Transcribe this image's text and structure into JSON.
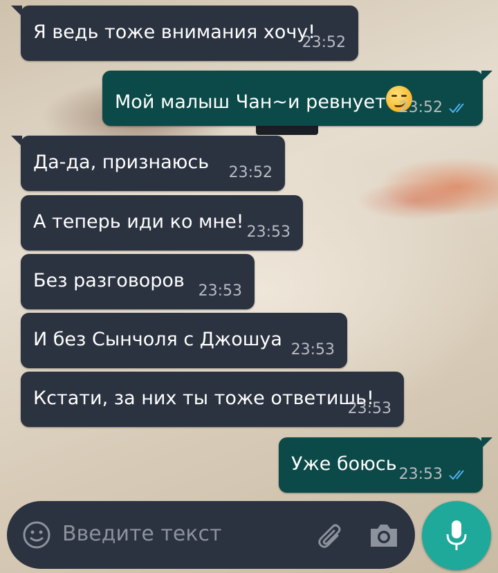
{
  "chat": {
    "messages": [
      {
        "direction": "incoming",
        "text": "Я ведь тоже внимания хочу!",
        "time": "23:52"
      },
      {
        "direction": "outgoing",
        "text": "Мой малыш Чан~и ревнует",
        "emoji": "smirking-face",
        "time": "23:52",
        "status": "read"
      },
      {
        "direction": "incoming",
        "text": "Да-да, признаюсь",
        "time": "23:52"
      },
      {
        "direction": "incoming",
        "text": "А теперь иди ко мне!",
        "time": "23:53"
      },
      {
        "direction": "incoming",
        "text": "Без разговоров",
        "time": "23:53"
      },
      {
        "direction": "incoming",
        "text": "И без Сынчоля с Джошуа",
        "time": "23:53"
      },
      {
        "direction": "incoming",
        "text": "Кстати, за них ты тоже ответишь!",
        "time": "23:53"
      },
      {
        "direction": "outgoing",
        "text": "Уже боюсь",
        "time": "23:53",
        "status": "read"
      }
    ]
  },
  "composer": {
    "placeholder": "Введите текст",
    "icons": [
      "emoji-icon",
      "attach-icon",
      "camera-icon",
      "mic-icon"
    ]
  },
  "colors": {
    "incoming_bubble": "#2b3240",
    "outgoing_bubble": "#0b4a48",
    "read_ticks": "#4fb3f0",
    "mic_button": "#1fa99a"
  }
}
